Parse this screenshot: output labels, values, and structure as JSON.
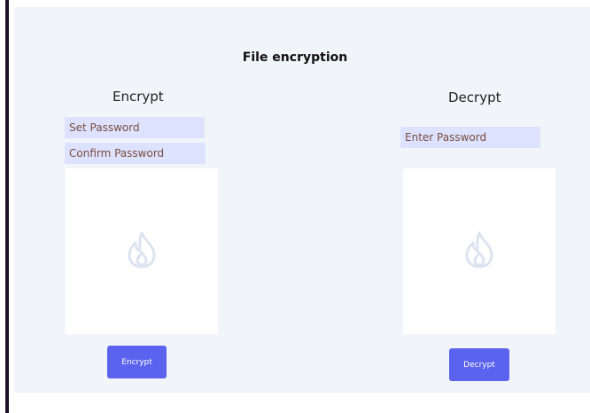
{
  "page": {
    "title": "File encryption"
  },
  "encrypt": {
    "heading": "Encrypt",
    "set_password_placeholder": "Set Password",
    "confirm_password_placeholder": "Confirm Password",
    "dropzone_icon": "flame-icon",
    "button_label": "Encrypt"
  },
  "decrypt": {
    "heading": "Decrypt",
    "enter_password_placeholder": "Enter Password",
    "dropzone_icon": "flame-icon",
    "button_label": "Decrypt"
  },
  "colors": {
    "accent": "#5b63ee",
    "input_bg": "#dde3ff",
    "panel_bg": "#f1f4f9",
    "icon": "#dbe4ef"
  }
}
